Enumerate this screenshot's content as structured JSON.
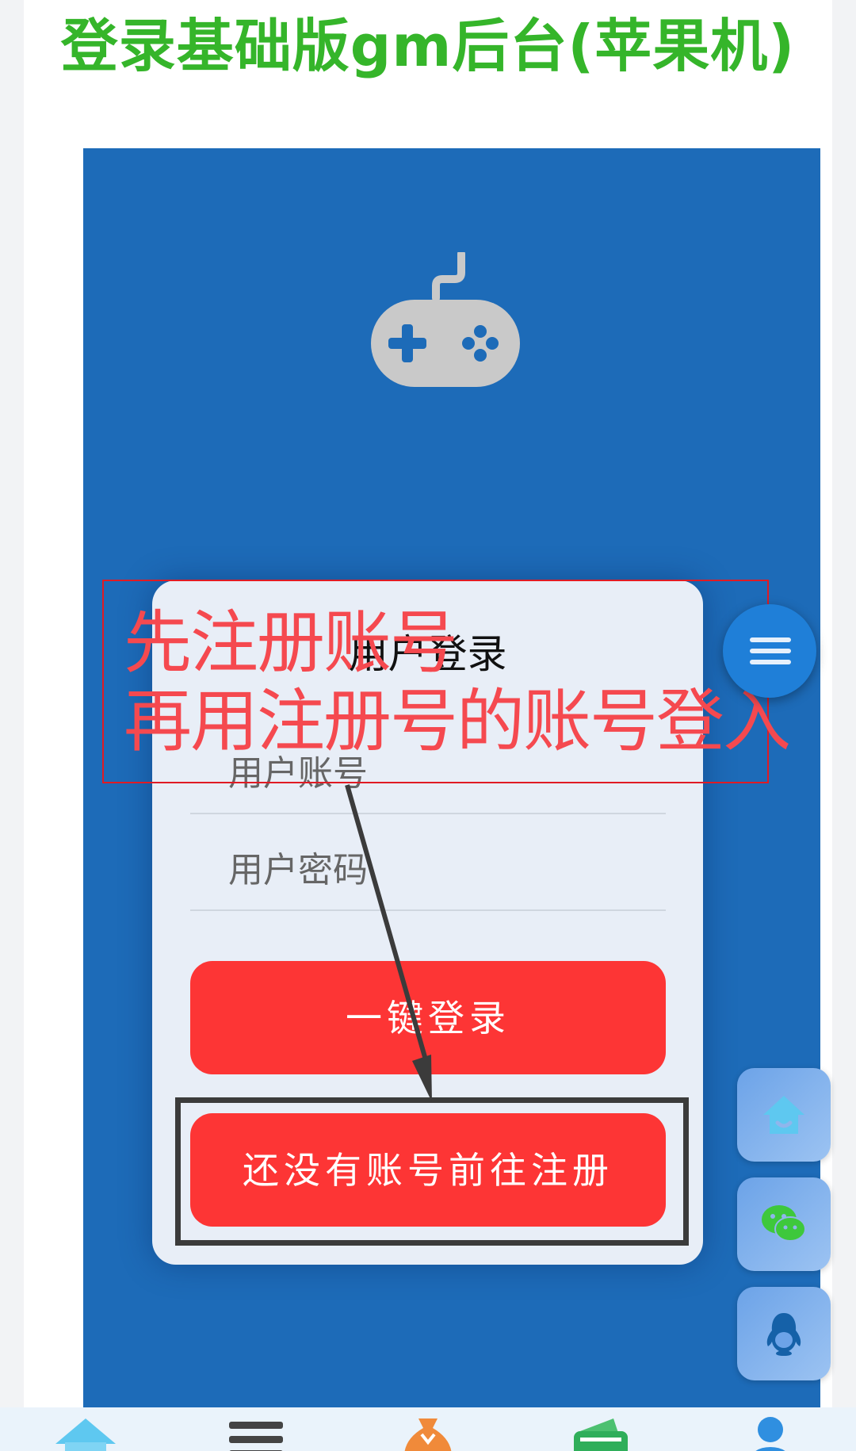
{
  "header": {
    "title": "登录基础版gm后台(苹果机)"
  },
  "login": {
    "title": "用户登录",
    "account_placeholder": "用户账号",
    "password_placeholder": "用户密码",
    "login_button": "一键登录",
    "register_button": "还没有账号前往注册"
  },
  "annotation": {
    "line1": "先注册账号",
    "line2": "再用注册号的账号登入",
    "color": "#f5494f"
  },
  "floating": {
    "menu_icon": "menu-icon",
    "side_icons": [
      "home-icon",
      "wechat-icon",
      "qq-icon"
    ]
  },
  "bottom_nav": {
    "icons": [
      "home-icon",
      "list-icon",
      "money-bag-icon",
      "wallet-icon",
      "user-icon"
    ]
  },
  "colors": {
    "title_green": "#35b52a",
    "panel_blue": "#1d6bb8",
    "button_red": "#fd3535"
  }
}
